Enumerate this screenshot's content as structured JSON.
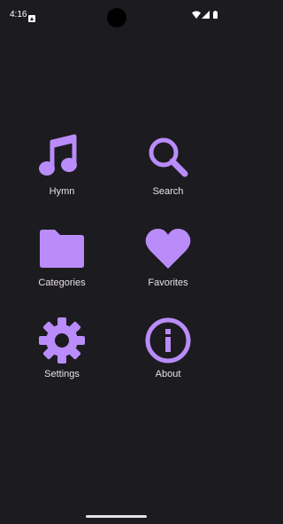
{
  "status_bar": {
    "time": "4:16",
    "icons": [
      "notification-icon",
      "wifi-icon",
      "signal-icon",
      "battery-icon"
    ]
  },
  "accent_color": "#b98cfa",
  "menu": {
    "items": [
      {
        "label": "Hymn",
        "icon": "music-note-icon"
      },
      {
        "label": "Search",
        "icon": "search-icon"
      },
      {
        "label": "Categories",
        "icon": "folder-icon"
      },
      {
        "label": "Favorites",
        "icon": "heart-icon"
      },
      {
        "label": "Settings",
        "icon": "gear-icon"
      },
      {
        "label": "About",
        "icon": "info-icon"
      }
    ]
  }
}
